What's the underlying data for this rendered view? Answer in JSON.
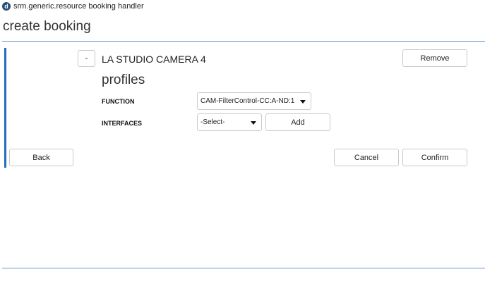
{
  "app": {
    "logo_letter": "d",
    "title": "srm.generic.resource booking handler"
  },
  "page": {
    "title": "create booking"
  },
  "resource": {
    "collapse_label": "-",
    "name": "LA STUDIO CAMERA 4",
    "remove_label": "Remove",
    "profiles_title": "profiles",
    "function": {
      "label": "FUNCTION",
      "value": "CAM-FilterControl-CC:A-ND:1"
    },
    "interfaces": {
      "label": "INTERFACES",
      "value": "-Select-",
      "add_label": "Add"
    }
  },
  "actions": {
    "back_label": "Back",
    "cancel_label": "Cancel",
    "confirm_label": "Confirm"
  },
  "colors": {
    "accent": "#1f6fbf",
    "rule": "#5b9bd5",
    "logo_bg": "#2a4f72"
  }
}
